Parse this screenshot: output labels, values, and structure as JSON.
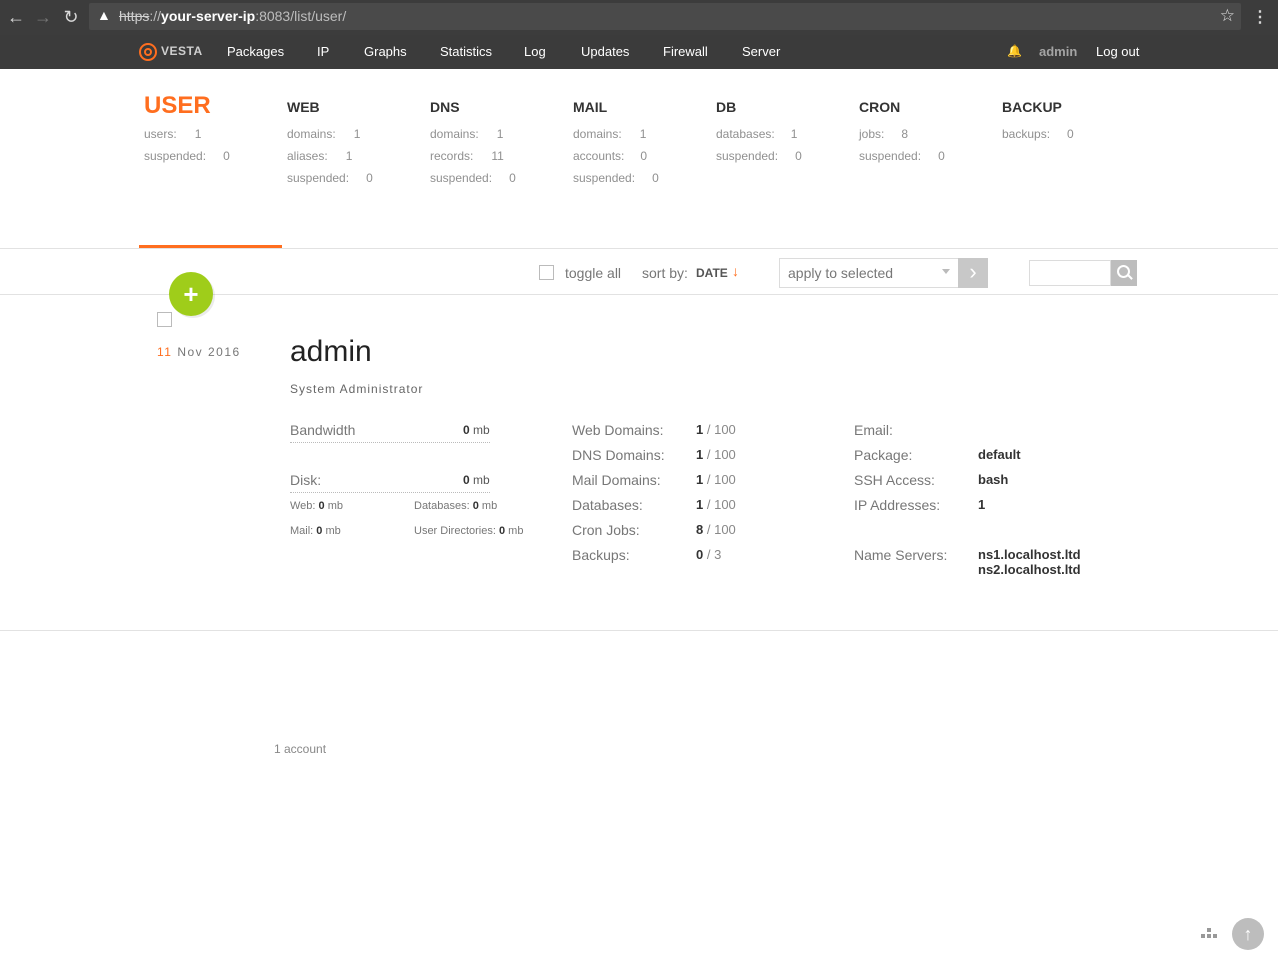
{
  "browser": {
    "url_scheme": "https",
    "url_sep": "://",
    "url_host": "your-server-ip",
    "url_rest": ":8083/list/user/"
  },
  "nav": {
    "logo": "VESTA",
    "items": [
      "Packages",
      "IP",
      "Graphs",
      "Statistics",
      "Log",
      "Updates",
      "Firewall",
      "Server"
    ],
    "user": "admin",
    "logout": "Log out"
  },
  "stats": [
    {
      "head": "USER",
      "rows": [
        {
          "k": "users:",
          "v": "1"
        },
        {
          "k": "suspended:",
          "v": "0"
        }
      ]
    },
    {
      "head": "WEB",
      "rows": [
        {
          "k": "domains:",
          "v": "1"
        },
        {
          "k": "aliases:",
          "v": "1"
        },
        {
          "k": "suspended:",
          "v": "0"
        }
      ]
    },
    {
      "head": "DNS",
      "rows": [
        {
          "k": "domains:",
          "v": "1"
        },
        {
          "k": "records:",
          "v": "11"
        },
        {
          "k": "suspended:",
          "v": "0"
        }
      ]
    },
    {
      "head": "MAIL",
      "rows": [
        {
          "k": "domains:",
          "v": "1"
        },
        {
          "k": "accounts:",
          "v": "0"
        },
        {
          "k": "suspended:",
          "v": "0"
        }
      ]
    },
    {
      "head": "DB",
      "rows": [
        {
          "k": "databases:",
          "v": "1"
        },
        {
          "k": "suspended:",
          "v": "0"
        }
      ]
    },
    {
      "head": "CRON",
      "rows": [
        {
          "k": "jobs:",
          "v": "8"
        },
        {
          "k": "suspended:",
          "v": "0"
        }
      ]
    },
    {
      "head": "BACKUP",
      "rows": [
        {
          "k": "backups:",
          "v": "0"
        }
      ]
    }
  ],
  "toolbar": {
    "toggle_all": "toggle all",
    "sort_by": "sort by:",
    "sort_value": "DATE",
    "sort_arrow": "↓",
    "apply_select": "apply to selected",
    "add_symbol": "+",
    "apply_symbol": "›"
  },
  "record": {
    "date_day": "11",
    "date_rest": "Nov 2016",
    "username": "admin",
    "fullname": "System Administrator",
    "bandwidth_label": "Bandwidth",
    "bandwidth_value": "0",
    "bandwidth_unit": "mb",
    "disk_label": "Disk:",
    "disk_value": "0",
    "disk_unit": "mb",
    "web_label": "Web:",
    "web_value": "0",
    "databases_label": "Databases:",
    "databases_value": "0",
    "mail_label": "Mail:",
    "mail_value": "0",
    "userdirs_label": "User Directories:",
    "userdirs_value": "0",
    "unit_mb": "mb",
    "limits": [
      {
        "label": "Web Domains:",
        "used": "1",
        "max": "/ 100"
      },
      {
        "label": "DNS Domains:",
        "used": "1",
        "max": "/ 100"
      },
      {
        "label": "Mail Domains:",
        "used": "1",
        "max": "/ 100"
      },
      {
        "label": "Databases:",
        "used": "1",
        "max": "/ 100"
      },
      {
        "label": "Cron Jobs:",
        "used": "8",
        "max": "/ 100"
      },
      {
        "label": "Backups:",
        "used": "0",
        "max": "/ 3"
      }
    ],
    "email_label": "Email:",
    "package_label": "Package:",
    "package_value": "default",
    "ssh_label": "SSH Access:",
    "ssh_value": "bash",
    "ip_label": "IP Addresses:",
    "ip_value": "1",
    "ns_label": "Name Servers:",
    "ns1": "ns1.localhost.ltd",
    "ns2": "ns2.localhost.ltd"
  },
  "footer": {
    "count": "1 account"
  },
  "colors": {
    "accent": "#ff6e1f",
    "add_button": "#9fcd1a",
    "nav_bg": "#3b3b3b"
  }
}
